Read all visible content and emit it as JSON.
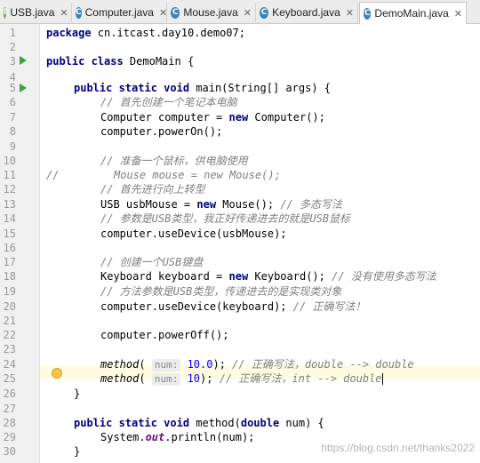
{
  "tabs": [
    {
      "label": "USB.java",
      "icon": "interface-icon"
    },
    {
      "label": "Computer.java",
      "icon": "class-icon"
    },
    {
      "label": "Mouse.java",
      "icon": "class-icon"
    },
    {
      "label": "Keyboard.java",
      "icon": "class-icon"
    },
    {
      "label": "DemoMain.java",
      "icon": "class-icon",
      "active": true
    }
  ],
  "line_numbers": [
    "1",
    "2",
    "3",
    "4",
    "5",
    "6",
    "7",
    "8",
    "9",
    "10",
    "11",
    "12",
    "13",
    "14",
    "15",
    "16",
    "17",
    "18",
    "19",
    "20",
    "21",
    "22",
    "23",
    "24",
    "25",
    "26",
    "27",
    "28",
    "29",
    "30"
  ],
  "code": {
    "l1_kw": "package",
    "l1_rest": " cn.itcast.day10.demo07;",
    "l3_kw": "public class",
    "l3_rest": " DemoMain {",
    "l5_kw": "public static void",
    "l5_rest": " main(String[] args) {",
    "l6": "// 首先创建一个笔记本电脑",
    "l7_a": "Computer computer = ",
    "l7_kw": "new",
    "l7_b": " Computer();",
    "l8": "computer.powerOn();",
    "l10": "// 准备一个鼠标，供电脑使用",
    "l11_prefix": "//",
    "l11_rest": "Mouse mouse = new Mouse();",
    "l12": "// 首先进行向上转型",
    "l13_a": "USB usbMouse = ",
    "l13_kw": "new",
    "l13_b": " Mouse(); ",
    "l13_c": "// 多态写法",
    "l14": "// 参数是USB类型，我正好传递进去的就是USB鼠标",
    "l15": "computer.useDevice(usbMouse);",
    "l17": "// 创建一个USB键盘",
    "l18_a": "Keyboard keyboard = ",
    "l18_kw": "new",
    "l18_b": " Keyboard(); ",
    "l18_c": "// 没有使用多态写法",
    "l19": "// 方法参数是USB类型，传递进去的是实现类对象",
    "l20_a": "computer.useDevice(keyboard); ",
    "l20_c": "// 正确写法！",
    "l22": "computer.powerOff();",
    "l24_m": "method",
    "l24_p": "(",
    "l24_hint": "num:",
    "l24_num": "10.0",
    "l24_b": "); ",
    "l24_c": "// 正确写法，double --> double",
    "l25_m": "method",
    "l25_p": "(",
    "l25_hint": "num:",
    "l25_num": "10",
    "l25_b": "); ",
    "l25_c": "// 正确写法，int --> double",
    "l26": "}",
    "l28_kw1": "public static void",
    "l28_mid": " method(",
    "l28_kw2": "double",
    "l28_rest": " num) {",
    "l29_a": "System.",
    "l29_fld": "out",
    "l29_b": ".println(num);",
    "l30": "}"
  },
  "watermark": "https://blog.csdn.net/thanks2022"
}
